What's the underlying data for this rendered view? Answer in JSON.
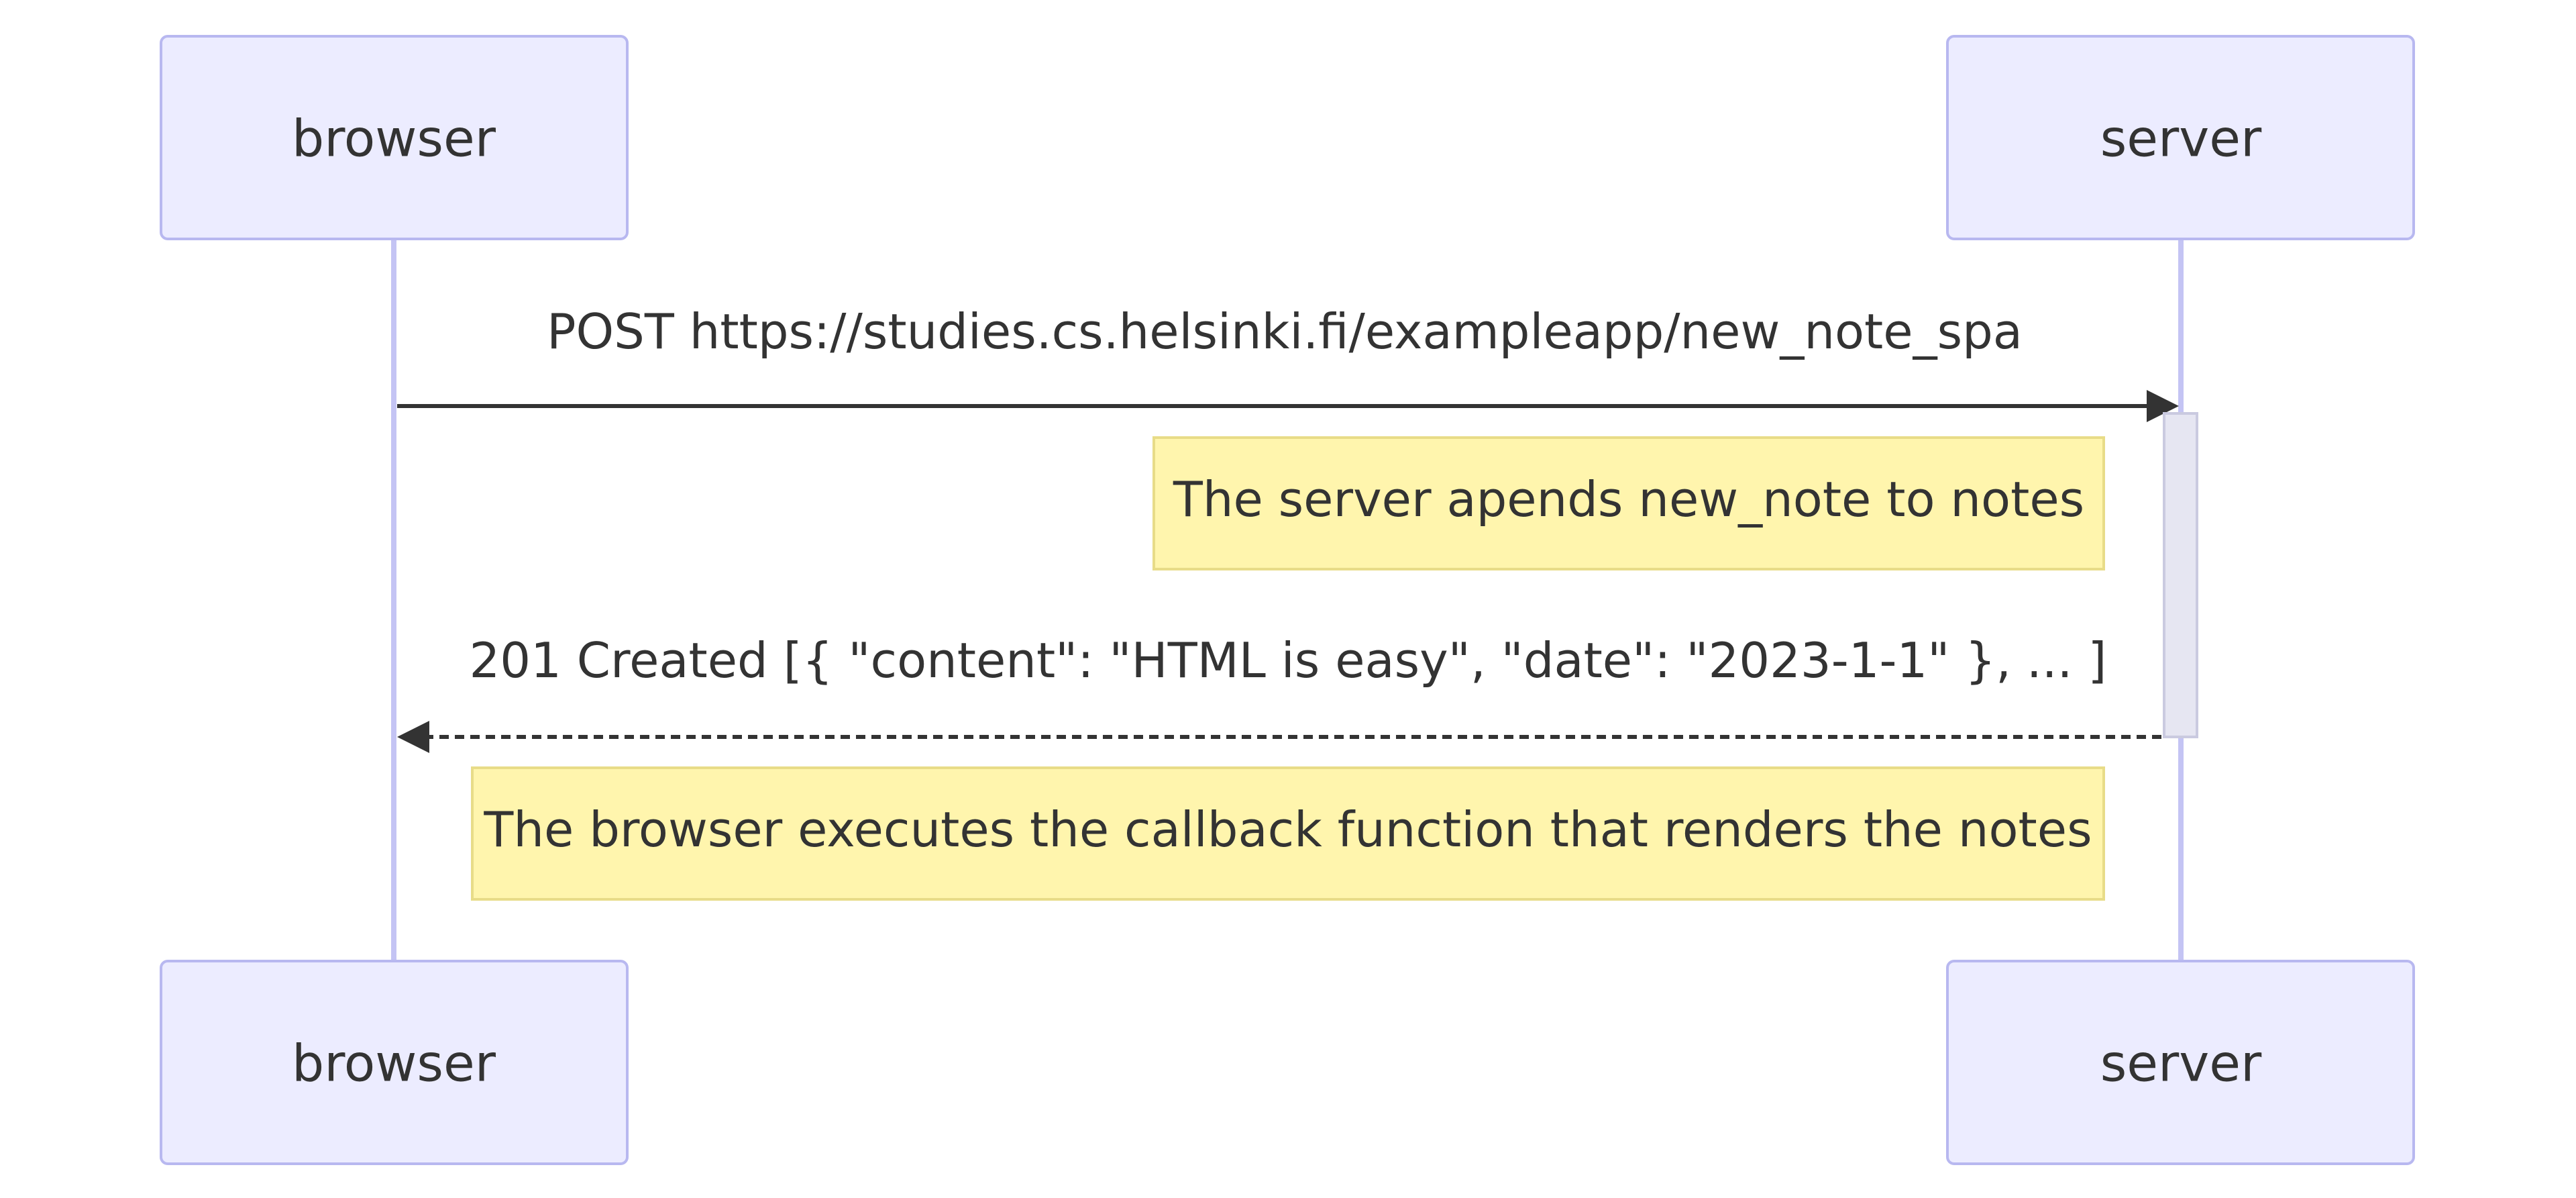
{
  "participants": {
    "browser": "browser",
    "server": "server"
  },
  "messages": [
    {
      "from": "browser",
      "to": "server",
      "text": "POST https://studies.cs.helsinki.fi/exampleapp/new_note_spa",
      "style": "solid"
    },
    {
      "from": "server",
      "to": "browser",
      "text": "201 Created [{ \"content\": \"HTML is easy\", \"date\": \"2023-1-1\" }, ... ]",
      "style": "dotted"
    }
  ],
  "notes": [
    {
      "position": "left of server",
      "text": "The server apends new_note to notes"
    },
    {
      "position": "over browser,server",
      "text": "The browser executes the callback function that renders the notes"
    }
  ],
  "colors": {
    "actor_fill": "#ECECFF",
    "actor_border": "#B8B8F0",
    "lifeline": "#C4C4F4",
    "note_fill": "#FFF5AD",
    "note_border": "#E8DC88",
    "line": "#333333",
    "activation_fill": "#E6E6F2"
  }
}
